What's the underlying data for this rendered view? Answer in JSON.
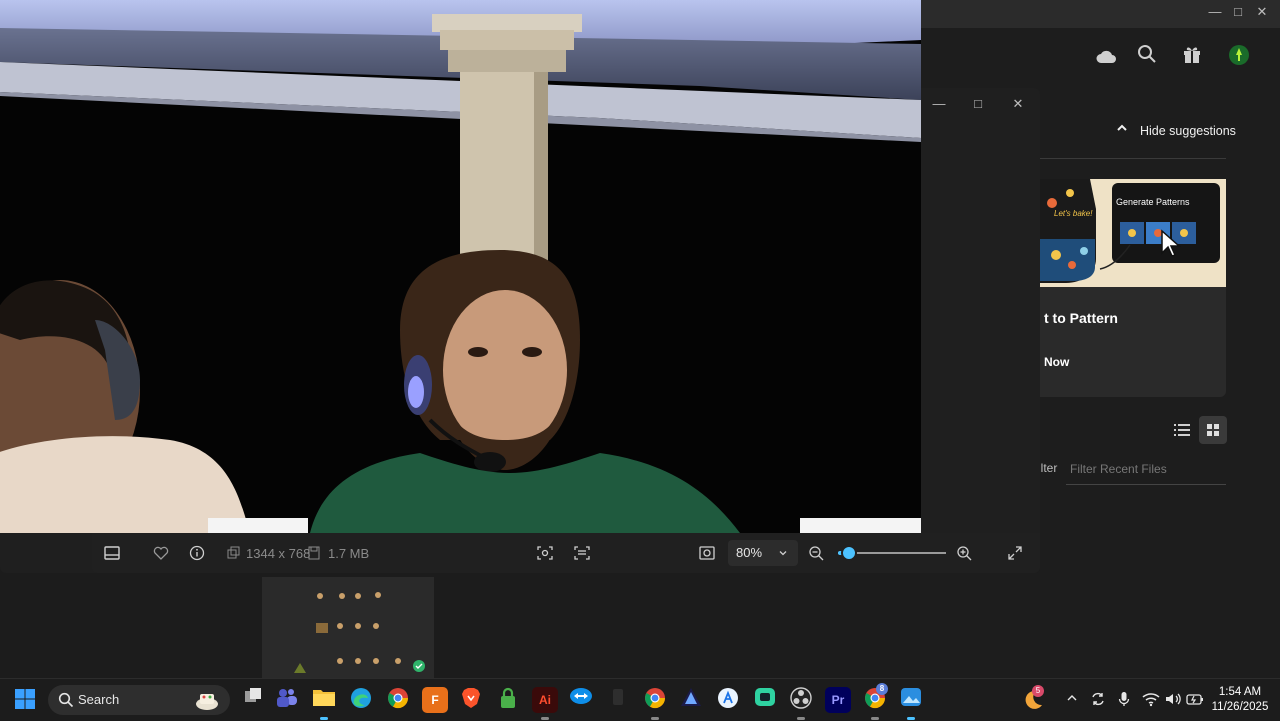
{
  "adobe": {
    "hide_suggestions": "Hide suggestions",
    "promo": {
      "badge": "Generate Patterns",
      "bake_text": "Let's bake!",
      "title": "t to Pattern",
      "cta": "Now"
    },
    "filter_label": "ilter",
    "filter_placeholder": "Filter Recent Files"
  },
  "viewer": {
    "dimensions": "1344 x 768",
    "file_size": "1.7 MB",
    "zoom": "80%",
    "zoom_fraction": 0.1
  },
  "taskbar": {
    "search_placeholder": "Search",
    "time": "1:54 AM",
    "date": "11/26/2025",
    "chrome_badge": "8",
    "weather_badge": "5",
    "app_labels": {
      "fresco": "F",
      "acrobat": "Ai",
      "premiere": "Pr"
    }
  }
}
